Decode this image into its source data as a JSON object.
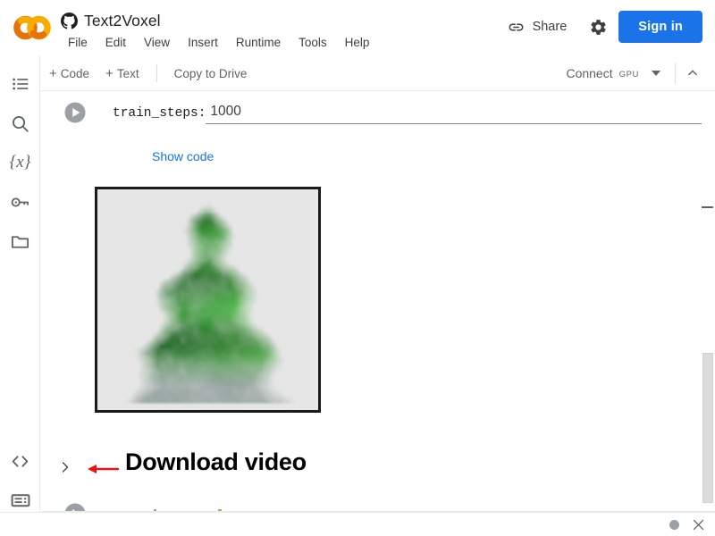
{
  "header": {
    "logo_icon": "colab-logo",
    "github_icon": "github-icon",
    "doc_title": "Text2Voxel",
    "menu": [
      {
        "label": "File"
      },
      {
        "label": "Edit"
      },
      {
        "label": "View"
      },
      {
        "label": "Insert"
      },
      {
        "label": "Runtime"
      },
      {
        "label": "Tools"
      },
      {
        "label": "Help"
      }
    ],
    "share_label": "Share",
    "share_icon": "link-icon",
    "settings_icon": "gear-icon",
    "signin_label": "Sign in"
  },
  "toolbar": {
    "add_code_plus": "+",
    "add_code_label": "Code",
    "add_text_plus": "+",
    "add_text_label": "Text",
    "copy_to_drive_label": "Copy to Drive",
    "connect_label": "Connect",
    "connect_badge": "GPU",
    "dropdown_icon": "chevron-down-icon",
    "collapse_icon": "chevron-up-icon"
  },
  "sidebar": {
    "items": [
      {
        "name": "table-of-contents",
        "icon": "list-icon"
      },
      {
        "name": "find-and-replace",
        "icon": "search-icon"
      },
      {
        "name": "variables",
        "icon": "variables-icon",
        "glyph": "{x}"
      },
      {
        "name": "secrets",
        "icon": "key-icon"
      },
      {
        "name": "files",
        "icon": "folder-icon"
      }
    ],
    "bottom_items": [
      {
        "name": "code-snippets",
        "icon": "code-brackets-icon"
      },
      {
        "name": "terminal",
        "icon": "terminal-icon"
      }
    ]
  },
  "notebook": {
    "cell": {
      "run_icon": "play-icon",
      "form_label": "train_steps:",
      "form_value": "1000",
      "form_placeholder": "",
      "show_code_label": "Show code"
    },
    "output": {
      "name": "rendered-voxel-image",
      "description": "green pine tree volumetric render",
      "background_color": "#e6e6e6",
      "border_color": "#1b1b1b"
    },
    "download_section": {
      "chevron_icon": "chevron-right-icon",
      "arrow_icon": "left-arrow-annotation",
      "arrow_color": "#ee1111",
      "title": "Download video"
    }
  },
  "statusbar": {
    "indicator_icon": "circle-icon",
    "close_icon": "close-icon"
  },
  "colors": {
    "accent_blue": "#1a73e8",
    "logo_orange": "#f9ab00",
    "logo_amber": "#e8710a",
    "text_primary": "#202124",
    "text_secondary": "#5f6368",
    "annotation_red": "#ee1111"
  }
}
